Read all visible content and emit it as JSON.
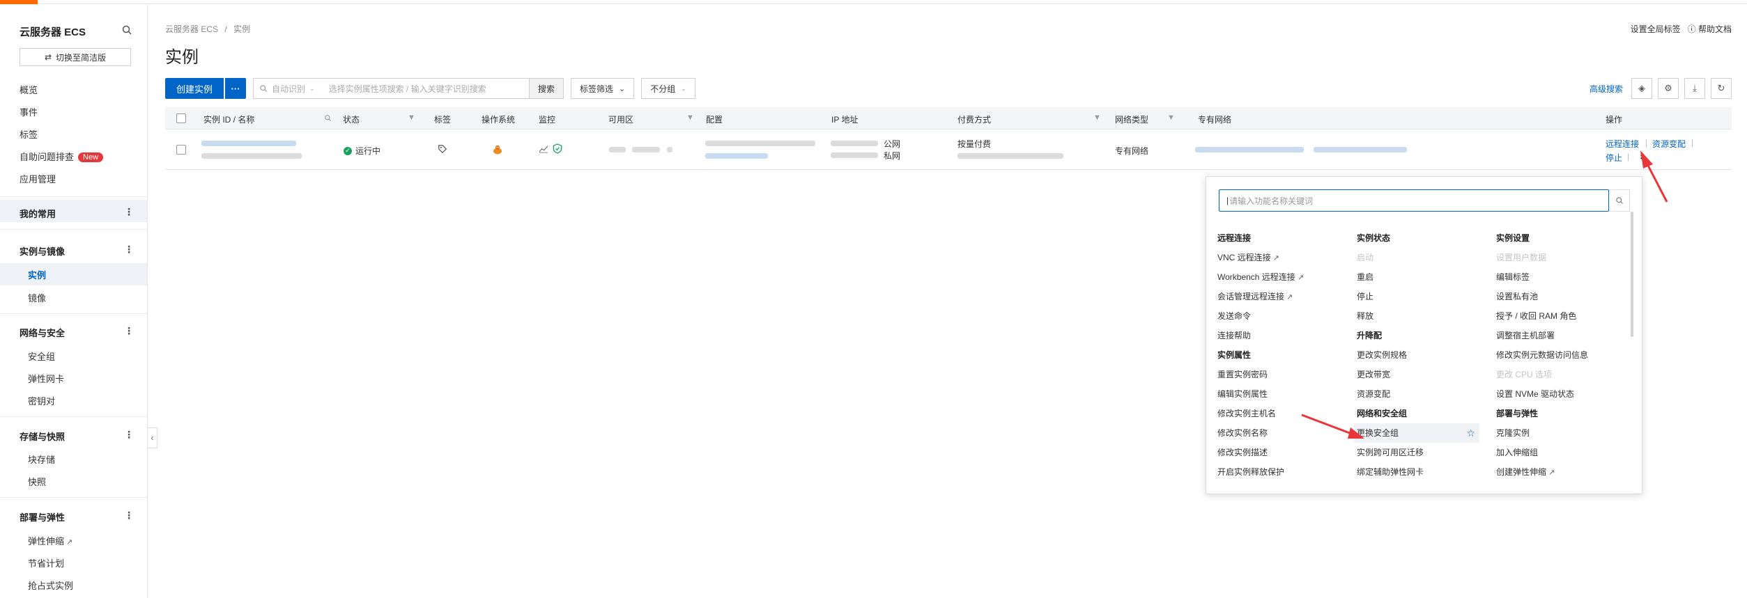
{
  "sidebar": {
    "title": "云服务器 ECS",
    "switch_label": "切换至简洁版",
    "top_items": [
      "概览",
      "事件",
      "标签",
      "自助问题排查",
      "应用管理"
    ],
    "new_badge": "New",
    "favorites_label": "我的常用",
    "section_instances": "实例与镜像",
    "instances_items": [
      "实例",
      "镜像"
    ],
    "section_network": "网络与安全",
    "network_items": [
      "安全组",
      "弹性网卡",
      "密钥对"
    ],
    "section_storage": "存储与快照",
    "storage_items": [
      "块存储",
      "快照"
    ],
    "section_deploy": "部署与弹性",
    "deploy_items": [
      "弹性伸缩",
      "节省计划",
      "抢占式实例"
    ],
    "more": "⋮"
  },
  "header": {
    "breadcrumb_root": "云服务器 ECS",
    "breadcrumb_sep": "/",
    "breadcrumb_current": "实例",
    "title": "实例",
    "global_tags": "设置全局标签",
    "help_docs": "帮助文档"
  },
  "toolbar": {
    "create_label": "创建实例",
    "create_more": "···",
    "search_prefix": "自动识别",
    "search_placeholder": "选择实例属性项搜索 / 输入关键字识别搜索",
    "search_button": "搜索",
    "tag_filter": "标签筛选",
    "group": "不分组",
    "advanced_search": "高级搜索"
  },
  "table": {
    "columns": [
      "实例 ID / 名称",
      "状态",
      "标签",
      "操作系统",
      "监控",
      "可用区",
      "配置",
      "IP 地址",
      "付费方式",
      "网络类型",
      "专有网络",
      "操作"
    ],
    "row": {
      "status": "运行中",
      "ip_public": "公网",
      "ip_private": "私网",
      "billing": "按量付费",
      "network_type": "专有网络",
      "op_remote": "远程连接",
      "op_change": "资源变配",
      "op_stop": "停止"
    }
  },
  "popover": {
    "search_placeholder": "请输入功能名称关键词",
    "col1": [
      {
        "type": "h",
        "label": "远程连接"
      },
      {
        "type": "i",
        "label": "VNC 远程连接",
        "ext": true
      },
      {
        "type": "i",
        "label": "Workbench 远程连接",
        "ext": true
      },
      {
        "type": "i",
        "label": "会话管理远程连接",
        "ext": true
      },
      {
        "type": "i",
        "label": "发送命令"
      },
      {
        "type": "i",
        "label": "连接帮助"
      },
      {
        "type": "h",
        "label": "实例属性"
      },
      {
        "type": "i",
        "label": "重置实例密码"
      },
      {
        "type": "i",
        "label": "编辑实例属性"
      },
      {
        "type": "i",
        "label": "修改实例主机名"
      },
      {
        "type": "i",
        "label": "修改实例名称"
      },
      {
        "type": "i",
        "label": "修改实例描述"
      },
      {
        "type": "i",
        "label": "开启实例释放保护"
      }
    ],
    "col2": [
      {
        "type": "h",
        "label": "实例状态"
      },
      {
        "type": "i",
        "label": "启动",
        "disabled": true
      },
      {
        "type": "i",
        "label": "重启"
      },
      {
        "type": "i",
        "label": "停止"
      },
      {
        "type": "i",
        "label": "释放"
      },
      {
        "type": "h",
        "label": "升降配"
      },
      {
        "type": "i",
        "label": "更改实例规格"
      },
      {
        "type": "i",
        "label": "更改带宽"
      },
      {
        "type": "i",
        "label": "资源变配"
      },
      {
        "type": "h",
        "label": "网络和安全组"
      },
      {
        "type": "i",
        "label": "更换安全组",
        "hover": true,
        "star": true
      },
      {
        "type": "i",
        "label": "实例跨可用区迁移"
      },
      {
        "type": "i",
        "label": "绑定辅助弹性网卡"
      }
    ],
    "col3": [
      {
        "type": "h",
        "label": "实例设置"
      },
      {
        "type": "i",
        "label": "设置用户数据",
        "disabled": true
      },
      {
        "type": "i",
        "label": "编辑标签"
      },
      {
        "type": "i",
        "label": "设置私有池"
      },
      {
        "type": "i",
        "label": "授予 / 收回 RAM 角色"
      },
      {
        "type": "i",
        "label": "调整宿主机部署"
      },
      {
        "type": "i",
        "label": "修改实例元数据访问信息"
      },
      {
        "type": "i",
        "label": "更改 CPU 选项",
        "disabled": true
      },
      {
        "type": "i",
        "label": "设置 NVMe 驱动状态"
      },
      {
        "type": "h",
        "label": "部署与弹性"
      },
      {
        "type": "i",
        "label": "克隆实例"
      },
      {
        "type": "i",
        "label": "加入伸缩组"
      },
      {
        "type": "i",
        "label": "创建弹性伸缩",
        "ext": true
      }
    ]
  },
  "colors": {
    "primary": "#0064c8",
    "accent": "#ff6a00",
    "success": "#1aa260",
    "annotation_arrow": "#e8363b"
  }
}
